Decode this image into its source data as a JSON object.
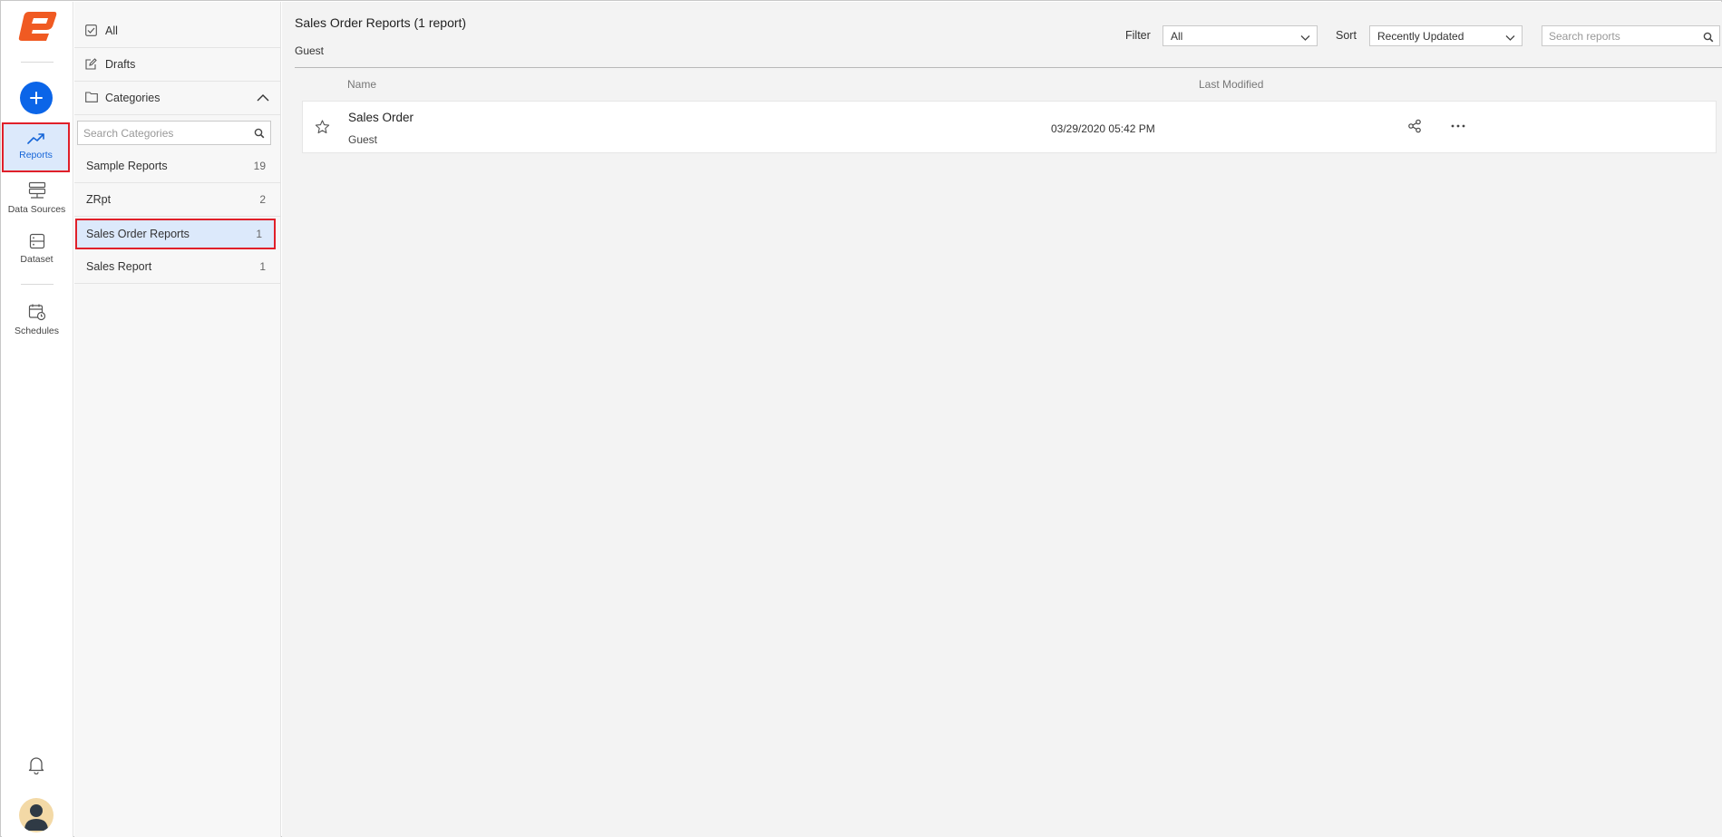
{
  "rail": {
    "items": [
      {
        "label": "Reports",
        "icon": "trend-icon"
      },
      {
        "label": "Data Sources",
        "icon": "database-icon"
      },
      {
        "label": "Dataset",
        "icon": "dataset-icon"
      },
      {
        "label": "Schedules",
        "icon": "calendar-clock-icon"
      }
    ],
    "accent": "#0b65e8",
    "logo_color": "#f05a22"
  },
  "categories_panel": {
    "all_label": "All",
    "drafts_label": "Drafts",
    "categories_label": "Categories",
    "search_placeholder": "Search Categories",
    "items": [
      {
        "name": "Sample Reports",
        "count": "19"
      },
      {
        "name": "ZRpt",
        "count": "2"
      },
      {
        "name": "Sales Order Reports",
        "count": "1"
      },
      {
        "name": "Sales Report",
        "count": "1"
      }
    ],
    "selected_index": 2
  },
  "main": {
    "title": "Sales Order Reports (1 report)",
    "subtitle": "Guest",
    "filter_label": "Filter",
    "filter_value": "All",
    "sort_label": "Sort",
    "sort_value": "Recently Updated",
    "search_placeholder": "Search reports",
    "columns": {
      "name": "Name",
      "modified": "Last Modified"
    },
    "reports": [
      {
        "name": "Sales Order",
        "owner": "Guest",
        "modified": "03/29/2020 05:42 PM"
      }
    ]
  }
}
